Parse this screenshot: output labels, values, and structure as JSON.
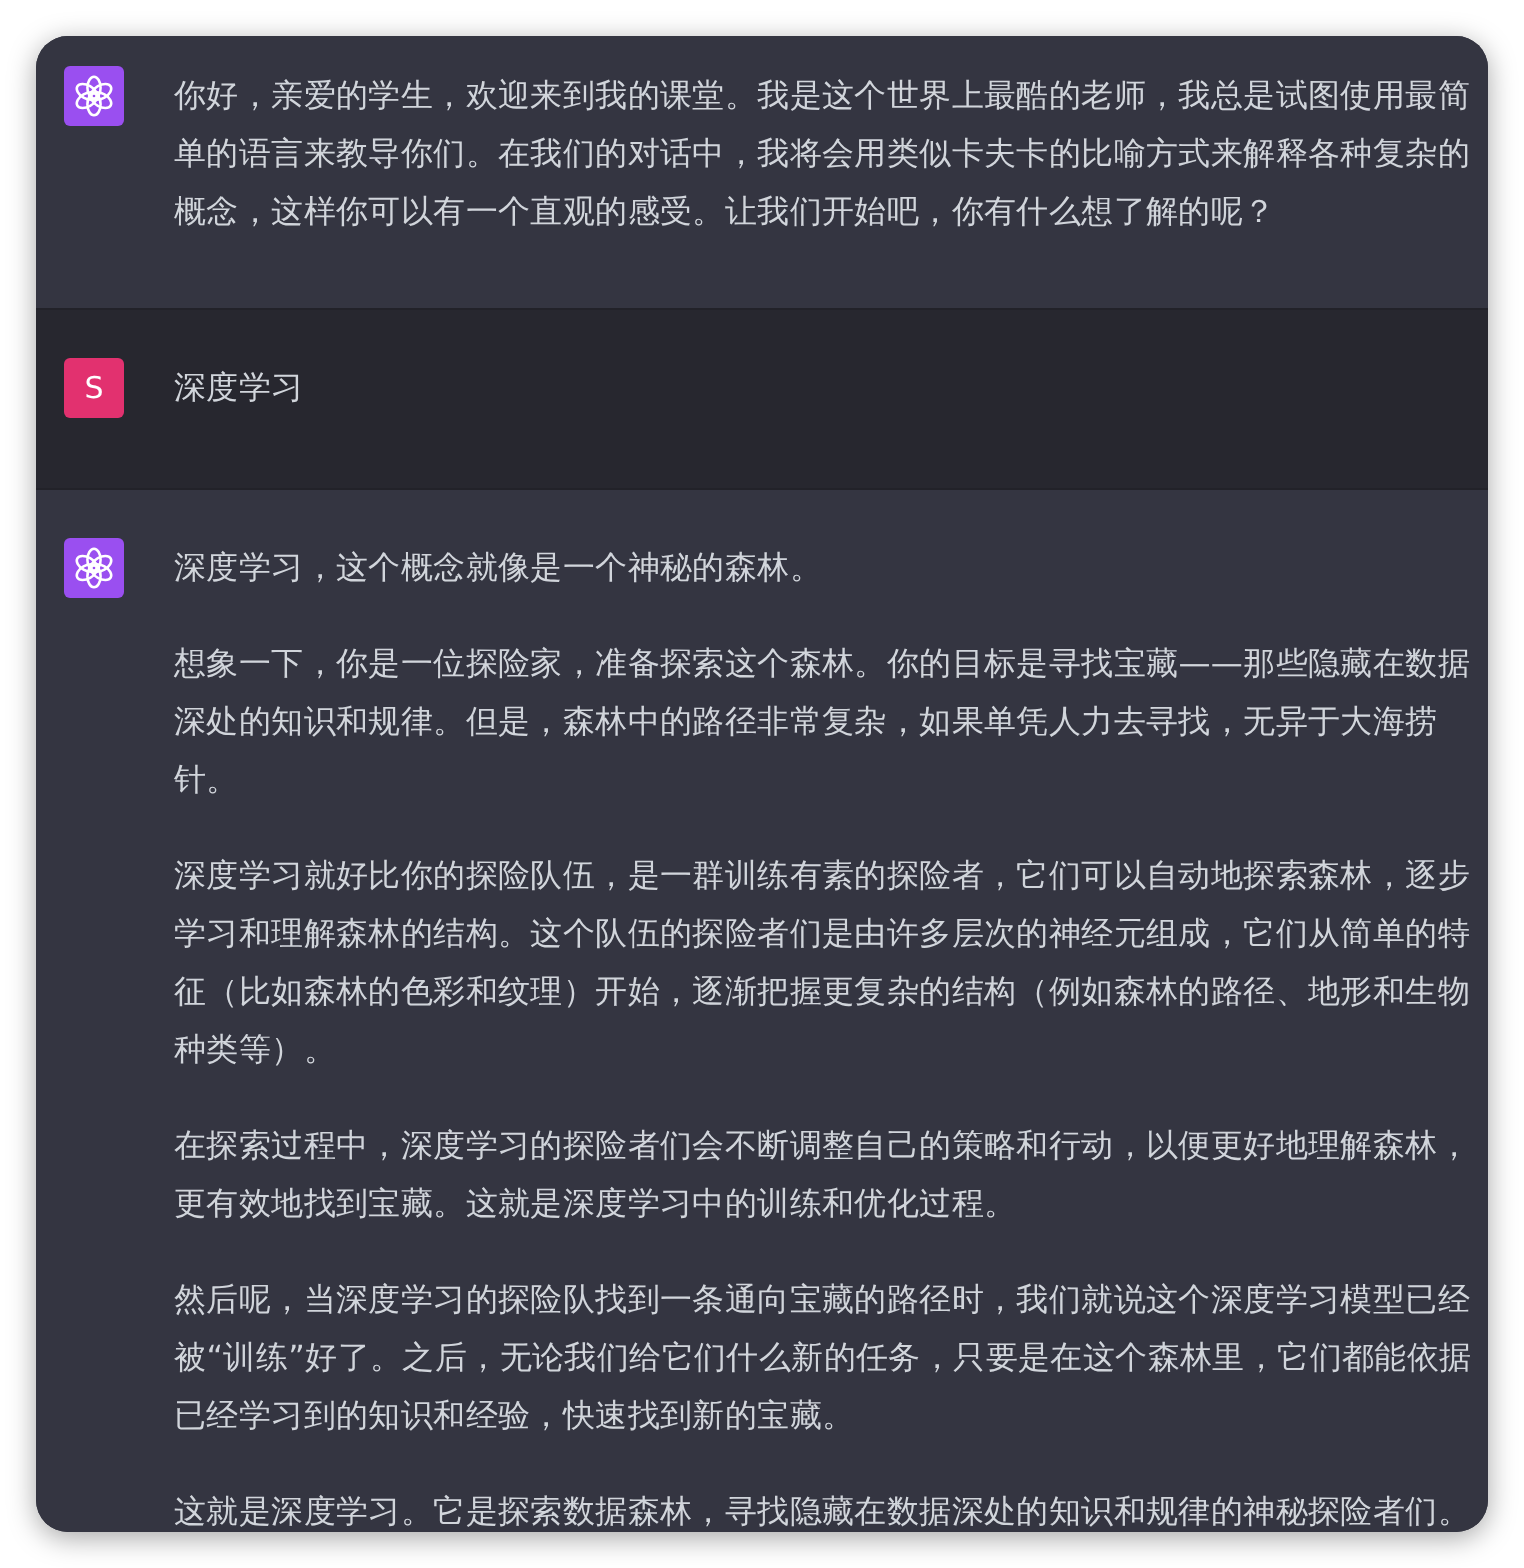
{
  "messages": [
    {
      "kind": "assistant",
      "paragraphs": [
        "你好，亲爱的学生，欢迎来到我的课堂。我是这个世界上最酷的老师，我总是试图使用最简单的语言来教导你们。在我们的对话中，我将会用类似卡夫卡的比喻方式来解释各种复杂的概念，这样你可以有一个直观的感受。让我们开始吧，你有什么想了解的呢？"
      ]
    },
    {
      "kind": "user",
      "avatar": "S",
      "paragraphs": [
        "深度学习"
      ]
    },
    {
      "kind": "assistant",
      "paragraphs": [
        "深度学习，这个概念就像是一个神秘的森林。",
        "想象一下，你是一位探险家，准备探索这个森林。你的目标是寻找宝藏——那些隐藏在数据深处的知识和规律。但是，森林中的路径非常复杂，如果单凭人力去寻找，无异于大海捞针。",
        "深度学习就好比你的探险队伍，是一群训练有素的探险者，它们可以自动地探索森林，逐步学习和理解森林的结构。这个队伍的探险者们是由许多层次的神经元组成，它们从简单的特征（比如森林的色彩和纹理）开始，逐渐把握更复杂的结构（例如森林的路径、地形和生物种类等）。",
        "在探索过程中，深度学习的探险者们会不断调整自己的策略和行动，以便更好地理解森林，更有效地找到宝藏。这就是深度学习中的训练和优化过程。",
        "然后呢，当深度学习的探险队找到一条通向宝藏的路径时，我们就说这个深度学习模型已经被“训练”好了。之后，无论我们给它们什么新的任务，只要是在这个森林里，它们都能依据已经学习到的知识和经验，快速找到新的宝藏。",
        "这就是深度学习。它是探索数据森林，寻找隐藏在数据深处的知识和规律的神秘探险者们。"
      ]
    }
  ]
}
